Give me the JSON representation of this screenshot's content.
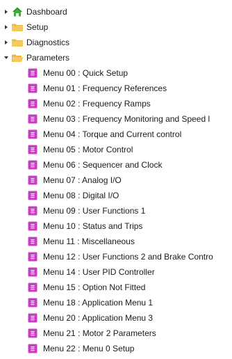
{
  "tree": {
    "nodes": [
      {
        "label": "Dashboard",
        "icon": "house-icon",
        "state": "collapsed"
      },
      {
        "label": "Setup",
        "icon": "folder-icon",
        "state": "collapsed"
      },
      {
        "label": "Diagnostics",
        "icon": "folder-icon",
        "state": "collapsed"
      },
      {
        "label": "Parameters",
        "icon": "folder-open-icon",
        "state": "expanded",
        "children": [
          "Menu 00 : Quick Setup",
          "Menu 01 : Frequency References",
          "Menu 02 : Frequency Ramps",
          "Menu 03 : Frequency Monitoring and Speed l",
          "Menu 04 : Torque and Current control",
          "Menu 05 : Motor Control",
          "Menu 06 : Sequencer and Clock",
          "Menu 07 : Analog I/O",
          "Menu 08 : Digital I/O",
          "Menu 09 : User Functions 1",
          "Menu 10 : Status and Trips",
          "Menu 11 : Miscellaneous",
          "Menu 12 : User Functions 2 and Brake Contro",
          "Menu 14 : User PID Controller",
          "Menu 15 : Option Not Fitted",
          "Menu 18 : Application Menu 1",
          "Menu 20 : Application Menu 3",
          "Menu 21 : Motor 2 Parameters",
          "Menu 22 : Menu 0 Setup"
        ]
      }
    ]
  },
  "colors": {
    "menu_icon": "#c93dc4",
    "folder": "#f5c95a",
    "house": "#3fae3a",
    "text": "#1a1a1a",
    "expander": "#333333"
  }
}
